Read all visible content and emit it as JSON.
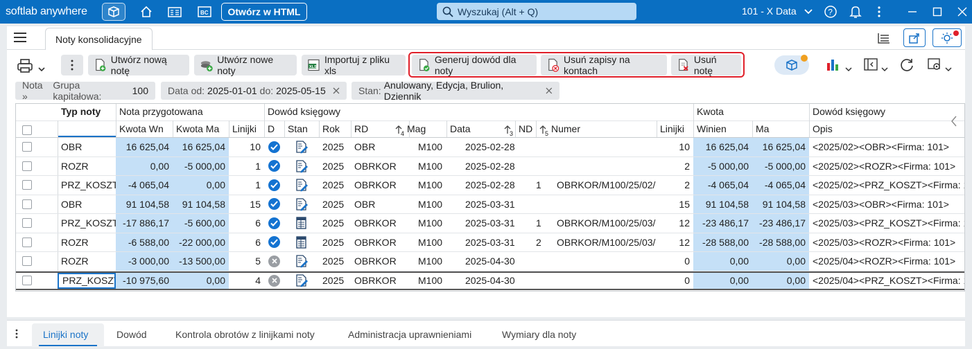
{
  "app": {
    "brand": "softlab anywhere",
    "open_html_label": "Otwórz w HTML",
    "search_placeholder": "Wyszukaj (Alt + Q)",
    "company": "101 - X Data"
  },
  "tabs": {
    "active": "Noty konsolidacyjne"
  },
  "toolbar": {
    "new_note": "Utwórz nową notę",
    "new_notes": "Utwórz nowe noty",
    "import_xls": "Importuj z pliku xls",
    "generate_proof": "Generuj dowód dla noty",
    "delete_entries": "Usuń zapisy na kontach",
    "delete_note": "Usuń notę"
  },
  "filters": {
    "f1_prefix": "Nota »",
    "f1_label": "Grupa kapitałowa:",
    "f1_value": "100",
    "f2_label": "Data",
    "f2_from_label": "od:",
    "f2_from": "2025-01-01",
    "f2_to_label": "do:",
    "f2_to": "2025-05-15",
    "f3_label": "Stan:",
    "f3_value": "Anulowany, Edycja, Brulion, Dziennik"
  },
  "grid": {
    "groups": {
      "typ": "Typ noty",
      "prep": "Nota przygotowana",
      "proof": "Dowód księgowy",
      "amount": "Kwota",
      "proof2": "Dowód księgowy"
    },
    "columns": {
      "kwota_wn": "Kwota Wn",
      "kwota_ma": "Kwota Ma",
      "linijki": "Linijki",
      "d": "D",
      "stan": "Stan",
      "rok": "Rok",
      "rd": "RD",
      "mag": "Mag",
      "mag_sort": "4",
      "data": "Data",
      "data_sort": "3",
      "nd": "ND",
      "numer": "Numer",
      "numer_sort": "5",
      "linijki2": "Linijki",
      "winien": "Winien",
      "ma": "Ma",
      "opis": "Opis"
    },
    "rows": [
      {
        "typ": "OBR",
        "wn": "16 625,04",
        "ma": "16 625,04",
        "lin": "10",
        "d": "ok",
        "stan": "edit",
        "rok": "2025",
        "rd": "OBR",
        "mag": "M100",
        "data": "2025-02-28",
        "nd": "",
        "numer": "",
        "lin2": "10",
        "winien": "16 625,04",
        "ma2": "16 625,04",
        "opis": "<2025/02><OBR><Firma: 101>"
      },
      {
        "typ": "ROZR",
        "wn": "0,00",
        "ma": "-5 000,00",
        "lin": "1",
        "d": "ok",
        "stan": "edit",
        "rok": "2025",
        "rd": "OBRKOR",
        "mag": "M100",
        "data": "2025-02-28",
        "nd": "",
        "numer": "",
        "lin2": "2",
        "winien": "-5 000,00",
        "ma2": "-5 000,00",
        "opis": "<2025/02><ROZR><Firma: 101>"
      },
      {
        "typ": "PRZ_KOSZT",
        "wn": "-4 065,04",
        "ma": "0,00",
        "lin": "1",
        "d": "ok",
        "stan": "edit",
        "rok": "2025",
        "rd": "OBRKOR",
        "mag": "M100",
        "data": "2025-02-28",
        "nd": "1",
        "numer": "OBRKOR/M100/25/02/",
        "lin2": "2",
        "winien": "-4 065,04",
        "ma2": "-4 065,04",
        "opis": "<2025/02><PRZ_KOSZT><Firma: 1"
      },
      {
        "typ": "OBR",
        "wn": "91 104,58",
        "ma": "91 104,58",
        "lin": "15",
        "d": "ok",
        "stan": "edit",
        "rok": "2025",
        "rd": "OBR",
        "mag": "M100",
        "data": "2025-03-31",
        "nd": "",
        "numer": "",
        "lin2": "15",
        "winien": "91 104,58",
        "ma2": "91 104,58",
        "opis": "<2025/03><OBR><Firma: 101>"
      },
      {
        "typ": "PRZ_KOSZT",
        "wn": "-17 886,17",
        "ma": "-5 600,00",
        "lin": "6",
        "d": "ok",
        "stan": "journal",
        "rok": "2025",
        "rd": "OBRKOR",
        "mag": "M100",
        "data": "2025-03-31",
        "nd": "1",
        "numer": "OBRKOR/M100/25/03/",
        "lin2": "12",
        "winien": "-23 486,17",
        "ma2": "-23 486,17",
        "opis": "<2025/03><PRZ_KOSZT><Firma: 1"
      },
      {
        "typ": "ROZR",
        "wn": "-6 588,00",
        "ma": "-22 000,00",
        "lin": "6",
        "d": "ok",
        "stan": "journal",
        "rok": "2025",
        "rd": "OBRKOR",
        "mag": "M100",
        "data": "2025-03-31",
        "nd": "2",
        "numer": "OBRKOR/M100/25/03/",
        "lin2": "12",
        "winien": "-28 588,00",
        "ma2": "-28 588,00",
        "opis": "<2025/03><ROZR><Firma: 101>"
      },
      {
        "typ": "ROZR",
        "wn": "-3 000,00",
        "ma": "-13 500,00",
        "lin": "5",
        "d": "x",
        "stan": "edit",
        "rok": "2025",
        "rd": "OBRKOR",
        "mag": "M100",
        "data": "2025-04-30",
        "nd": "",
        "numer": "",
        "lin2": "0",
        "winien": "0,00",
        "ma2": "0,00",
        "opis": "<2025/04><ROZR><Firma: 101>"
      },
      {
        "typ": "PRZ_KOSZT",
        "wn": "-10 975,60",
        "ma": "0,00",
        "lin": "4",
        "d": "x",
        "stan": "edit",
        "rok": "2025",
        "rd": "OBRKOR",
        "mag": "M100",
        "data": "2025-04-30",
        "nd": "",
        "numer": "",
        "lin2": "0",
        "winien": "0,00",
        "ma2": "0,00",
        "opis": "<2025/04><PRZ_KOSZT><Firma: 1"
      }
    ]
  },
  "bottom_tabs": [
    "Linijki noty",
    "Dowód",
    "Kontrola obrotów z linijkami noty",
    "Administracja uprawnieniami",
    "Wymiary dla noty"
  ],
  "colors": {
    "brand": "#0a6fc2",
    "highlight": "#c5e0f7",
    "danger": "#e0202a"
  }
}
